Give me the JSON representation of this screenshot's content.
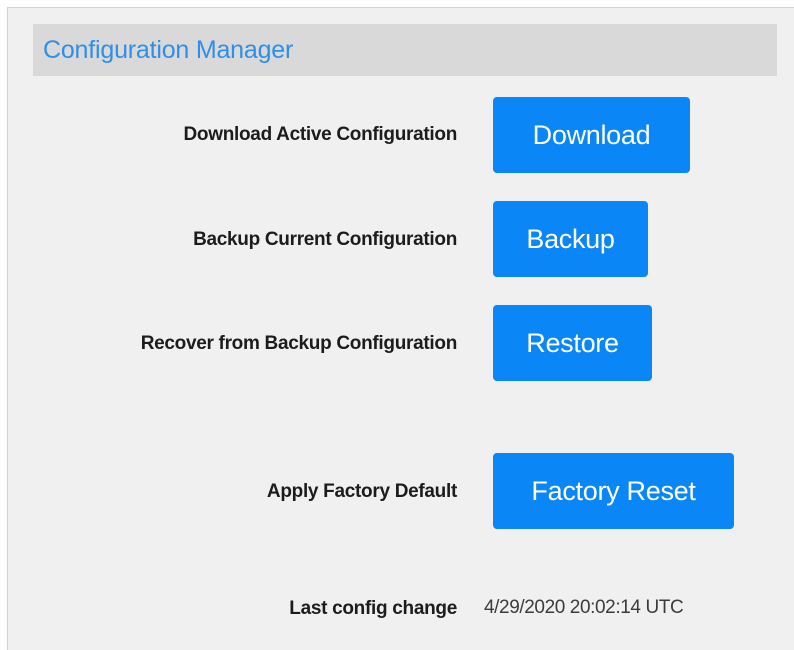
{
  "panel": {
    "title": "Configuration Manager"
  },
  "rows": {
    "download": {
      "label": "Download Active Configuration",
      "button": "Download"
    },
    "backup": {
      "label": "Backup Current Configuration",
      "button": "Backup"
    },
    "restore": {
      "label": "Recover from Backup Configuration",
      "button": "Restore"
    },
    "factory": {
      "label": "Apply Factory Default",
      "button": "Factory Reset"
    }
  },
  "last_change": {
    "label": "Last config change",
    "value": "4/29/2020 20:02:14 UTC"
  },
  "colors": {
    "accent": "#0a86f7",
    "title": "#2f8fe8",
    "header_bg": "#d9d9d9",
    "panel_bg": "#f0f0f0"
  }
}
